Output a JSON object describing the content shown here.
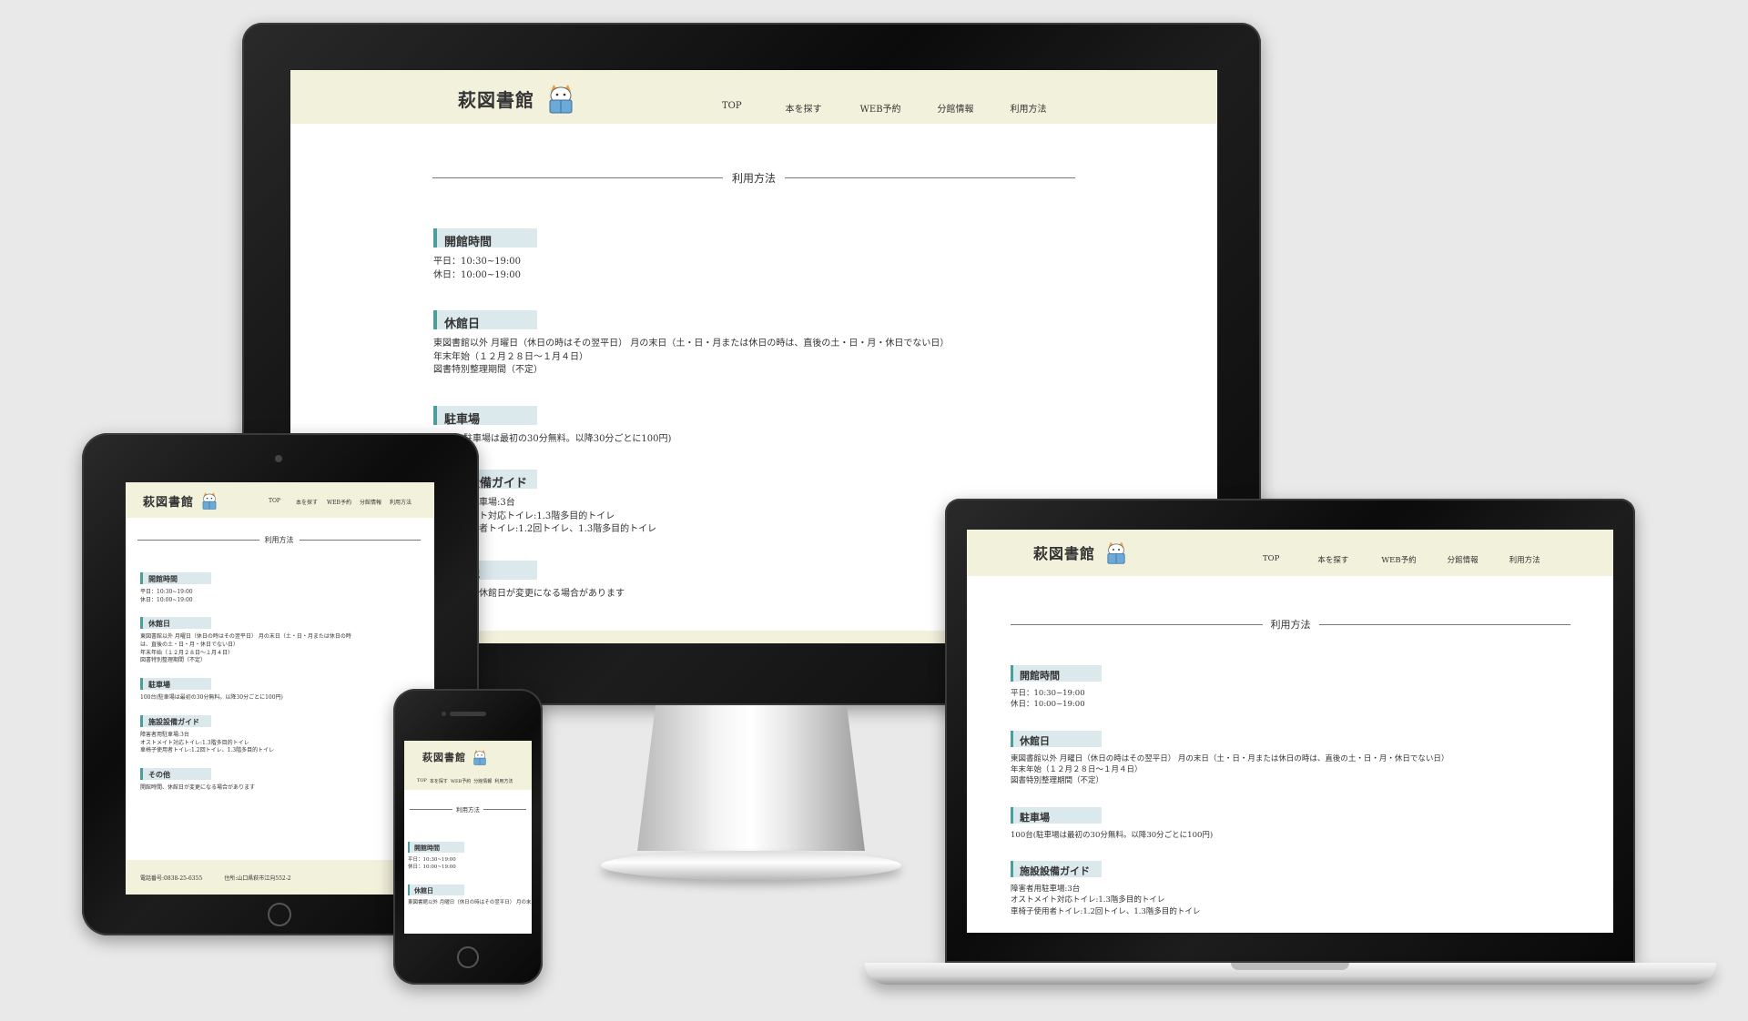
{
  "site": {
    "logo": "萩図書館",
    "nav": [
      "TOP",
      "本を探す",
      "WEB予約",
      "分館情報",
      "利用方法"
    ],
    "page_title": "利用方法"
  },
  "sections": {
    "hours": {
      "title": "開館時間",
      "weekday": "平日：10:30~19:00",
      "holiday": "休日：10:00~19:00"
    },
    "closed": {
      "title": "休館日",
      "line1": "東図書館以外 月曜日（休日の時はその翌平日） 月の末日（土・日・月または休日の時は、直後の土・日・月・休日でない日）",
      "line1_a": "東図書館以外 月曜日（休日の時はその翌平日） 月の末日（土・日・月または休日の時",
      "line1_b": "は、直後の土・日・月・休日でない日）",
      "line2": "年末年始（１２月２８日～１月４日）",
      "line3": "図書特別整理期間（不定）"
    },
    "parking": {
      "title": "駐車場",
      "text": "100台(駐車場は最初の30分無料。以降30分ごとに100円)",
      "text_partial": "車場は最初の30分無料。以降30分ごとに100円)"
    },
    "facility": {
      "title": "施設設備ガイド",
      "title_partial": "設備ガイド",
      "line1": "障害者用駐車場:3台",
      "line2": "オストメイト対応トイレ:1.3階多目的トイレ",
      "line3": "車椅子使用者トイレ:1.2回トイレ、1.3階多目的トイレ",
      "line1_partial": "車場:3台",
      "line2_partial": "ト対応トイレ:1.3階多目的トイレ",
      "line3_partial": "者トイレ:1.2回トイレ、1.3階多目的トイレ"
    },
    "other": {
      "title": "その他",
      "title_partial": "他",
      "text": "開館時間、休館日が変更になる場合があります",
      "text_partial": "休館日が変更になる場合があります"
    }
  },
  "footer": {
    "phone": "電話番号:0838-25-6355",
    "address": "住所:山口県萩市江向552-2"
  },
  "colors": {
    "header_bg": "#f2f1dc",
    "heading_bg": "#dbe8ec",
    "heading_accent": "#4d9e9a"
  }
}
